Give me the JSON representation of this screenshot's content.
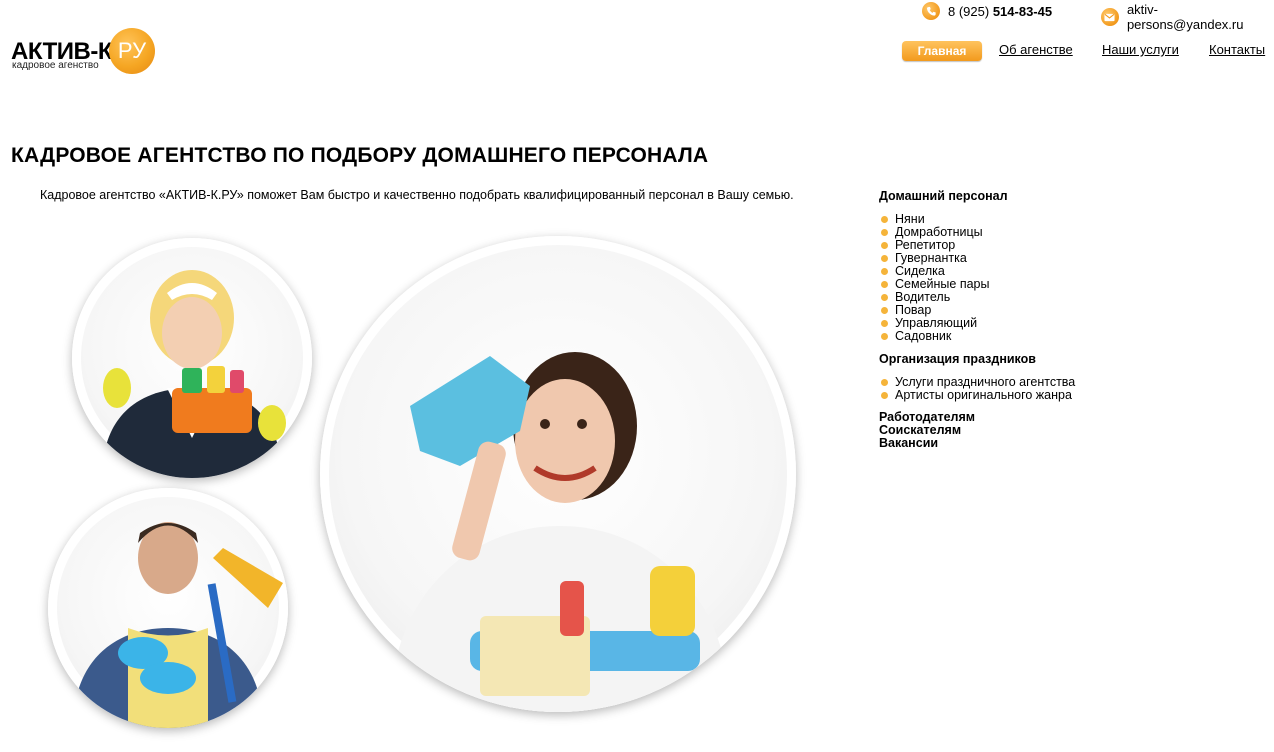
{
  "contacts": {
    "phone_prefix": "8 (925)",
    "phone_main": "514-83-45",
    "email": "aktiv-persons@yandex.ru",
    "phone_icon": "phone-icon",
    "email_icon": "envelope-icon"
  },
  "logo": {
    "name": "АКТИВ-К",
    "badge": "РУ",
    "tagline": "кадровое агенство"
  },
  "nav": {
    "items": [
      {
        "label": "Главная"
      },
      {
        "label": "Об агенстве"
      },
      {
        "label": "Наши услуги"
      },
      {
        "label": "Контакты"
      }
    ]
  },
  "main": {
    "title": "КАДРОВОЕ АГЕНТСТВО ПО ПОДБОРУ ДОМАШНЕГО ПЕРСОНАЛА",
    "intro": "Кадровое агентство «АКТИВ-К.РУ» поможет Вам быстро и качественно подобрать квалифицированный персонал в Вашу семью."
  },
  "sidebar": {
    "sections": [
      {
        "heading": "Домашний персонал",
        "items": [
          "Няни",
          "Домработницы",
          "Репетитор",
          "Гувернантка",
          "Сиделка",
          "Семейные пары",
          "Водитель",
          "Повар",
          "Управляющий",
          "Садовник"
        ]
      },
      {
        "heading": "Организация праздников",
        "items": [
          "Услуги праздничного агентства",
          "Артисты оригинального жанра"
        ]
      }
    ],
    "links": [
      "Работодателям",
      "Соискателям",
      "Вакансии"
    ]
  },
  "colors": {
    "accent": "#f5a623",
    "bullet": "#f5b43a"
  }
}
